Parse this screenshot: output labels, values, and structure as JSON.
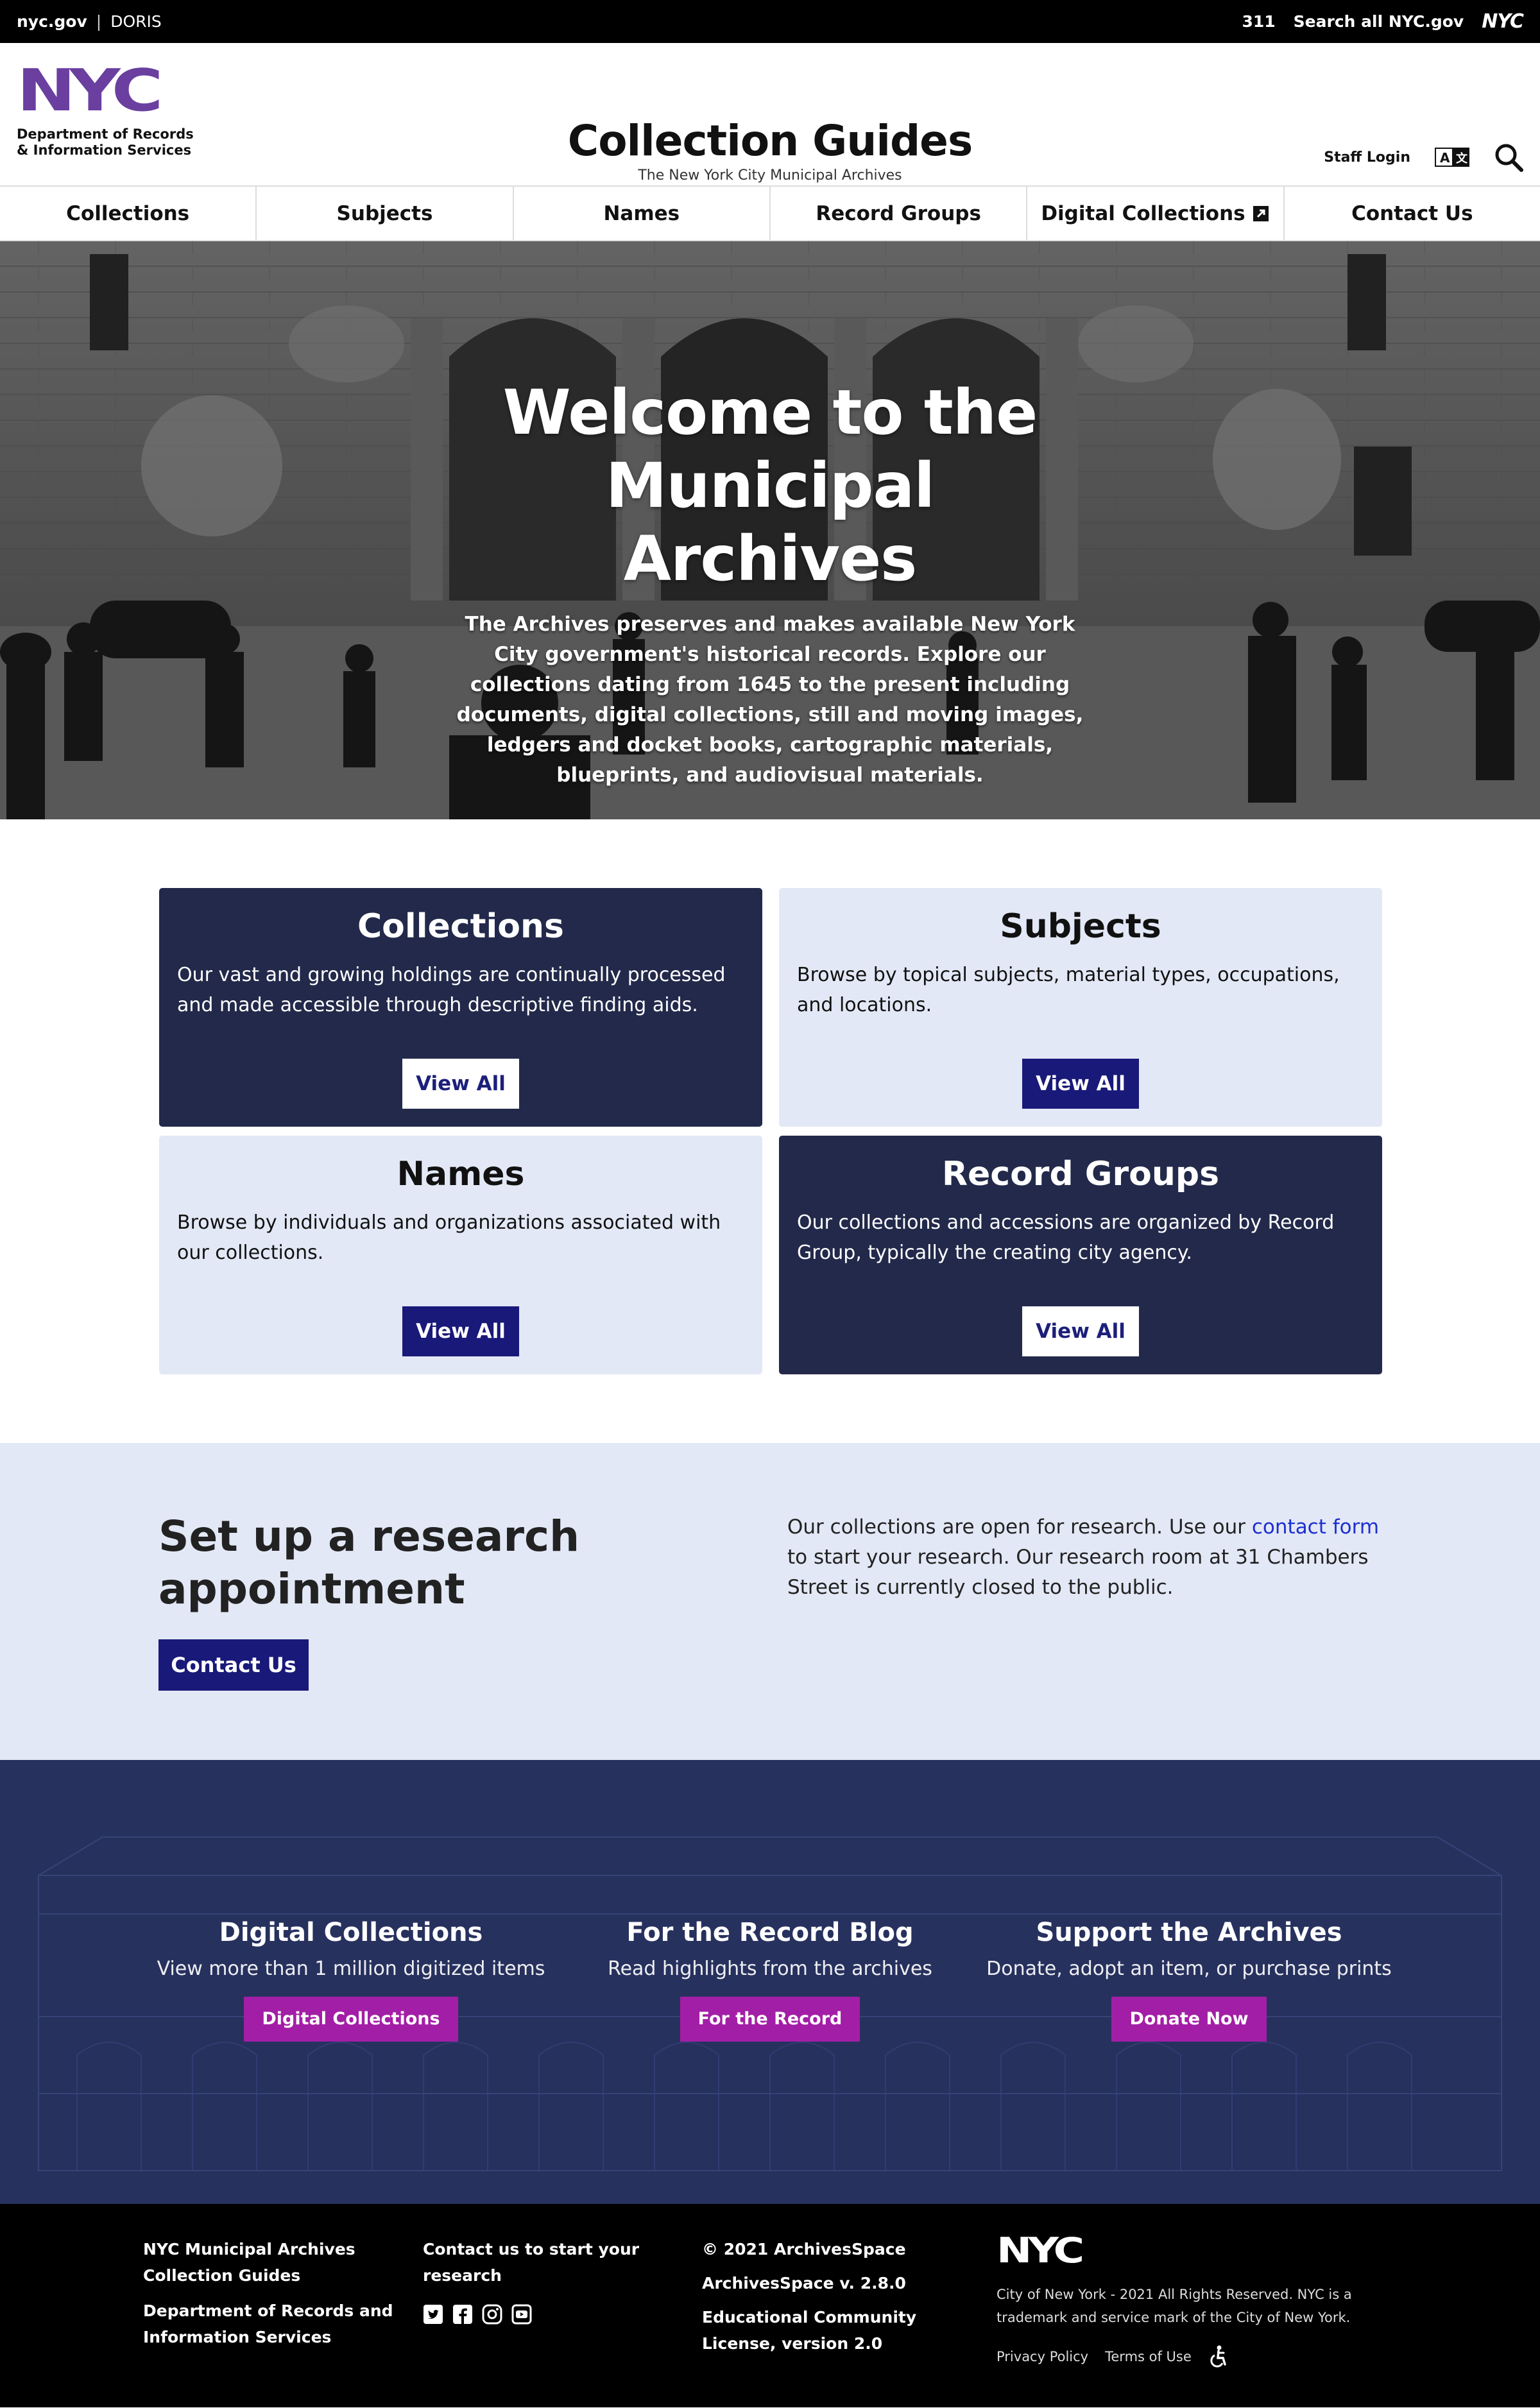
{
  "topbar": {
    "nycgov": "nyc.gov",
    "separator": "|",
    "doris": "DORIS",
    "three11": "311",
    "search_all": "Search all NYC.gov",
    "nyc_logo_text": "NYC"
  },
  "header": {
    "logo_text_line1": "Department of Records",
    "logo_text_line2": "& Information Services",
    "logo_mark_text": "NYC",
    "title": "Collection Guides",
    "subtitle": "The New York City Municipal Archives",
    "staff_login": "Staff Login",
    "icons": [
      "translate-icon",
      "search-icon"
    ]
  },
  "nav": {
    "items": [
      "Collections",
      "Subjects",
      "Names",
      "Record Groups",
      "Digital Collections",
      "Contact Us"
    ]
  },
  "hero": {
    "title_line1": "Welcome to the",
    "title_line2": "Municipal Archives",
    "text": "The Archives preserves and makes available New York City government's historical records. Explore our collections dating from 1645 to the present including documents, digital collections, still and moving images, ledgers and docket books, cartographic materials, blueprints, and audiovisual materials."
  },
  "cards": [
    {
      "title": "Collections",
      "text": "Our vast and growing holdings are continually processed and made accessible through descriptive finding aids.",
      "button": "View All",
      "style": "dark"
    },
    {
      "title": "Subjects",
      "text": "Browse by topical subjects, material types, occupations, and locations.",
      "button": "View All",
      "style": "light"
    },
    {
      "title": "Names",
      "text": "Browse by individuals and organizations associated with our collections.",
      "button": "View All",
      "style": "light"
    },
    {
      "title": "Record Groups",
      "text": "Our collections and accessions are organized by Record Group, typically the creating city agency.",
      "button": "View All",
      "style": "dark"
    }
  ],
  "research": {
    "title_line1": "Set up a research",
    "title_line2": "appointment",
    "button": "Contact Us",
    "text_before": "Our collections are open for research. Use our ",
    "link": "contact form",
    "text_after": " to start your research. Our research room at 31 Chambers Street is currently closed to the public."
  },
  "promos": [
    {
      "title": "Digital Collections",
      "desc": "View more than 1 million digitized items",
      "button": "Digital Collections"
    },
    {
      "title": "For the Record Blog",
      "desc": "Read highlights from the archives",
      "button": "For the Record"
    },
    {
      "title": "Support the Archives",
      "desc": "Donate, adopt an item, or purchase prints",
      "button": "Donate Now"
    }
  ],
  "footer": {
    "col1_line1": "NYC Municipal Archives",
    "col1_line2": "Collection Guides",
    "col1_line3": "Department of Records and",
    "col1_line4": "Information Services",
    "col2_line1": "Contact us to start your",
    "col2_line2": "research",
    "social_icons": [
      "twitter-icon",
      "facebook-icon",
      "instagram-icon",
      "youtube-icon"
    ],
    "col3_line1": "© 2021 ArchivesSpace",
    "col3_line2": "ArchivesSpace v. 2.8.0",
    "col3_line3": "Educational Community",
    "col3_line4": "License, version 2.0",
    "nyc_logo_text": "NYC",
    "legal": "City of New York - 2021 All Rights Reserved. NYC is a trademark and service mark of the City of New York.",
    "privacy": "Privacy Policy",
    "terms": "Terms of Use"
  },
  "colors": {
    "brand_purple": "#6a3fa0",
    "navy": "#22294a",
    "button_blue": "#19197a",
    "light_bg": "#e3e8f6",
    "magenta": "#a31ea6",
    "blueprint": "#27315e"
  }
}
